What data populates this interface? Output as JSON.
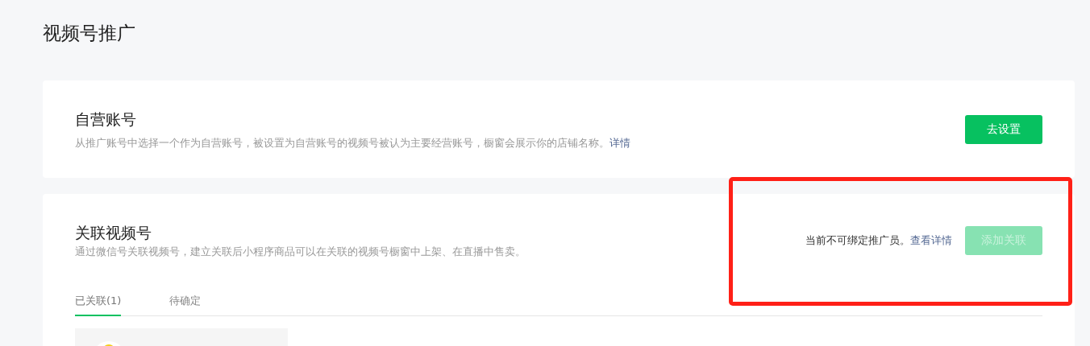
{
  "page_title": "视频号推广",
  "self_account": {
    "title": "自营账号",
    "description": "从推广账号中选择一个作为自营账号，被设置为自营账号的视频号被认为主要经营账号，橱窗会展示你的店铺名称。",
    "link": "详情",
    "button": {
      "label": "去设置",
      "disabled": false
    }
  },
  "linked_channels": {
    "title": "关联视频号",
    "description": "通过微信号关联视频号，建立关联后小程序商品可以在关联的视频号橱窗中上架、在直播中售卖。",
    "notice": "当前不可绑定推广员。",
    "notice_link": "查看详情",
    "button": {
      "label": "添加关联",
      "disabled": true
    },
    "tabs": [
      {
        "label": "已关联(1)",
        "selected": true
      },
      {
        "label": "待确定",
        "selected": false
      }
    ]
  },
  "annotation": {
    "kind": "frame"
  }
}
